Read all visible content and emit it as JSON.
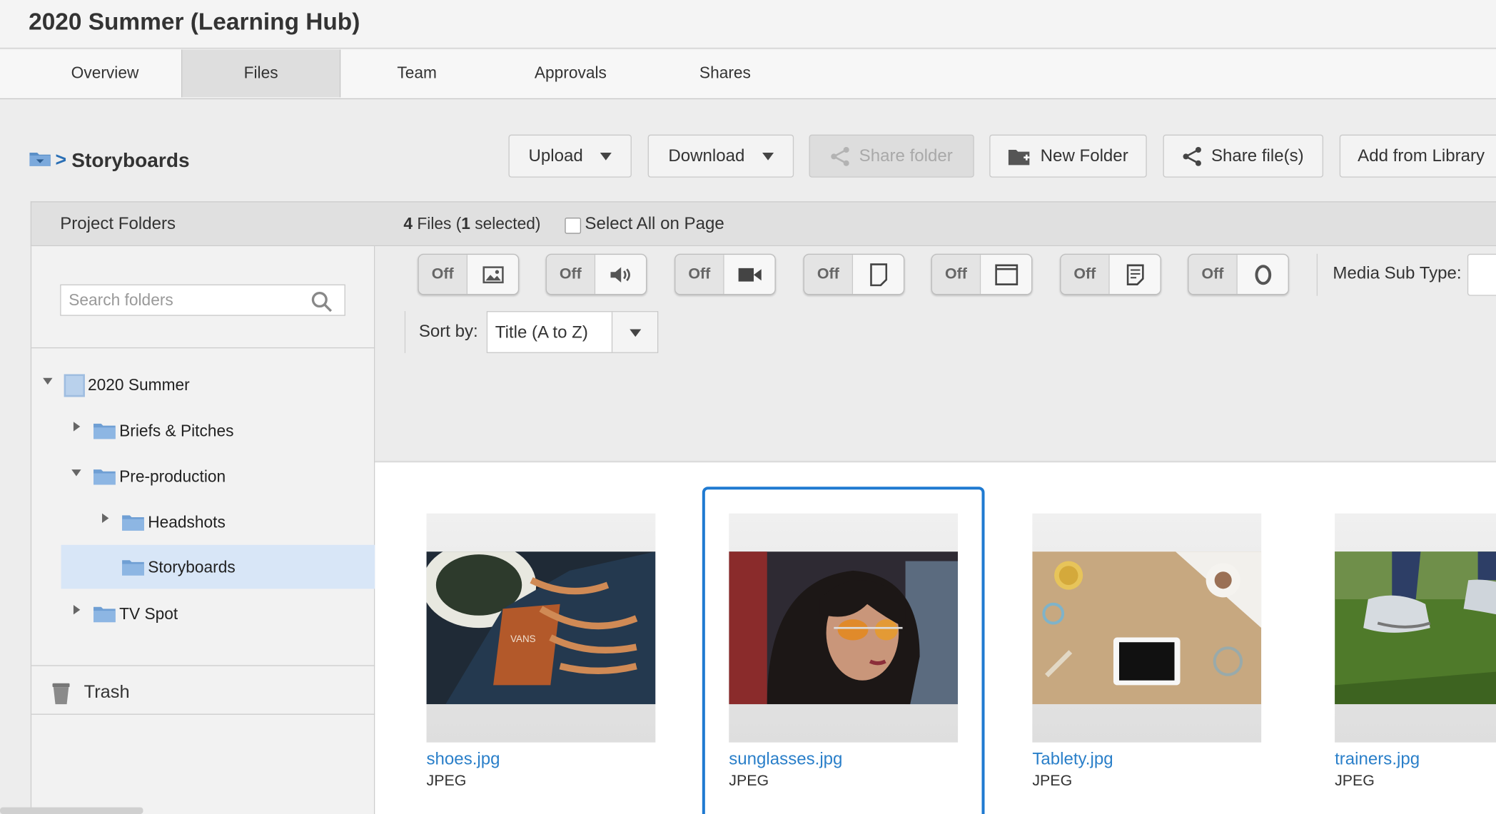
{
  "app": {
    "title": "2020 Summer (Learning Hub)"
  },
  "tabs": [
    {
      "label": "Overview",
      "active": false
    },
    {
      "label": "Files",
      "active": true
    },
    {
      "label": "Team",
      "active": false
    },
    {
      "label": "Approvals",
      "active": false
    },
    {
      "label": "Shares",
      "active": false
    }
  ],
  "breadcrumb": {
    "icon": "folder-icon",
    "separator": ">",
    "current": "Storyboards"
  },
  "toolbar": {
    "upload": "Upload",
    "download": "Download",
    "share_folder": "Share folder",
    "new_folder": "New Folder",
    "share_files": "Share file(s)",
    "add_from_library": "Add from Library"
  },
  "panel": {
    "project_folders": "Project Folders",
    "file_count": "4",
    "files_word": " Files (",
    "selected_count": "1",
    "selected_word": " selected)",
    "select_all": "Select All on Page"
  },
  "search": {
    "placeholder": "Search folders"
  },
  "tree": [
    {
      "label": "2020 Summer",
      "expanded": true
    },
    {
      "label": "Briefs & Pitches",
      "expanded": false
    },
    {
      "label": "Pre-production",
      "expanded": true
    },
    {
      "label": "Headshots",
      "expanded": false
    },
    {
      "label": "Storyboards",
      "selected": true
    },
    {
      "label": "TV Spot",
      "expanded": false
    }
  ],
  "trash": {
    "label": "Trash"
  },
  "filters": {
    "off_label": "Off",
    "toggles": [
      "image-icon",
      "audio-icon",
      "video-icon",
      "document-icon",
      "window-icon",
      "text-document-icon",
      "other-icon"
    ],
    "media_sub_type_label": "Media Sub Type:",
    "sort_label": "Sort by:",
    "sort_value": "Title (A to Z)"
  },
  "files": [
    {
      "name": "shoes.jpg",
      "type": "JPEG",
      "selected": false
    },
    {
      "name": "sunglasses.jpg",
      "type": "JPEG",
      "selected": true
    },
    {
      "name": "Tablety.jpg",
      "type": "JPEG",
      "selected": false
    },
    {
      "name": "trainers.jpg",
      "type": "JPEG",
      "selected": false
    }
  ],
  "colors": {
    "accent": "#1f7ad1",
    "link": "#2a7fc9",
    "selected_row": "#d8e6f7"
  }
}
